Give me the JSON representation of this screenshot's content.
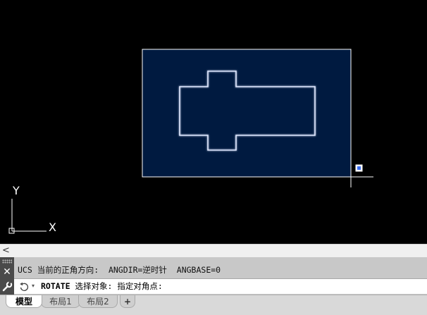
{
  "canvas": {
    "background": "#000000",
    "selection_fill": "#001a40",
    "selection_border": "#ffffff",
    "shape_stroke": "#dfe8ff",
    "grip_color": "#3a6ef0",
    "ucs": {
      "y_label": "Y",
      "x_label": "X"
    }
  },
  "scrollbar": {
    "left_arrow": "<"
  },
  "command_line": {
    "close_glyph": "✕",
    "history_line": "UCS 当前的正角方向:  ANGDIR=逆时针  ANGBASE=0",
    "input_keyword": "ROTATE",
    "input_prompt": " 选择对象: 指定对角点:",
    "dropdown_glyph": "▾",
    "icon": "command-history-icon"
  },
  "tabs": [
    {
      "label": "模型",
      "active": true
    },
    {
      "label": "布局1",
      "active": false
    },
    {
      "label": "布局2",
      "active": false
    },
    {
      "label": "+",
      "active": false
    }
  ]
}
